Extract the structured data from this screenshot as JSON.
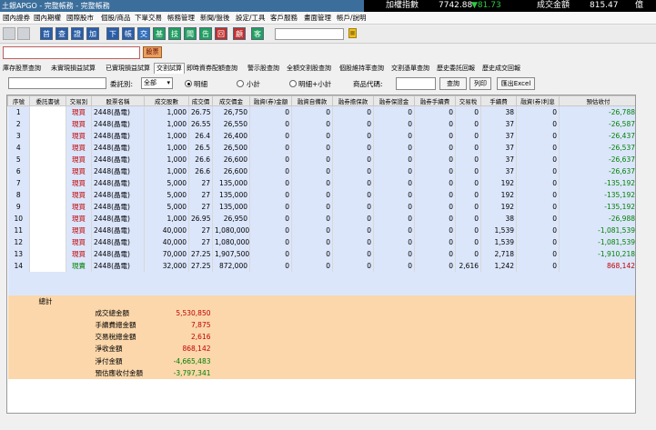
{
  "title": "土銀APGO - 完整帳務 - 完整帳務",
  "ticker": {
    "label": "加權指數",
    "value": "7742.88",
    "change": "▼81.73",
    "turnover_label": "成交金額",
    "turnover": "815.47",
    "unit": "億"
  },
  "menu": [
    "國內證券",
    "國內期權",
    "國際股市",
    "個股/商品",
    "下單交易",
    "帳務管理",
    "新聞/盤後",
    "設定/工具",
    "客戶服務",
    "畫面管理",
    "帳戶/說明"
  ],
  "toolbar": {
    "buttons": [
      "首",
      "查",
      "證",
      "加",
      "下",
      "帳",
      "交",
      "基",
      "技",
      "聞",
      "告",
      "回",
      "顧",
      "客"
    ],
    "combo_value": ""
  },
  "stock_button": "股票",
  "tabs": [
    "庫存股票查詢",
    "未實現損益試算",
    "已實現損益試算",
    "交割試算",
    "即時資券配額查詢",
    "警示股查詢",
    "全額交割股查詢",
    "個股維持率查詢",
    "交割憑單查詢",
    "歷史委託回報",
    "歷史成交回報"
  ],
  "filters": {
    "trade_label": "委託別:",
    "trade_value": "全部",
    "radio_detail": "明細",
    "radio_subtotal": "小計",
    "radio_both": "明細+小計",
    "product_label": "商品代碼:",
    "query": "查詢",
    "print": "列印",
    "export": "匯出Excel"
  },
  "columns": [
    "序號",
    "委託書號",
    "交易別",
    "股票名稱",
    "成交股數",
    "成交價",
    "成交價金",
    "融資(券)金額",
    "融資自備款",
    "融券擔保款",
    "融券保證金",
    "融券手續費",
    "交易稅",
    "手續費",
    "融資(券)利息",
    "預估收付"
  ],
  "rows": [
    {
      "no": "1",
      "side": "現買",
      "name": "2448(晶電)",
      "qty": "1,000",
      "price": "26.75",
      "amount": "26,750",
      "m1": "0",
      "m2": "0",
      "m3": "0",
      "m4": "0",
      "m5": "0",
      "tax": "0",
      "fee": "38",
      "int": "0",
      "net": "-26,788"
    },
    {
      "no": "2",
      "side": "現買",
      "name": "2448(晶電)",
      "qty": "1,000",
      "price": "26.55",
      "amount": "26,550",
      "m1": "0",
      "m2": "0",
      "m3": "0",
      "m4": "0",
      "m5": "0",
      "tax": "0",
      "fee": "37",
      "int": "0",
      "net": "-26,587"
    },
    {
      "no": "3",
      "side": "現買",
      "name": "2448(晶電)",
      "qty": "1,000",
      "price": "26.4",
      "amount": "26,400",
      "m1": "0",
      "m2": "0",
      "m3": "0",
      "m4": "0",
      "m5": "0",
      "tax": "0",
      "fee": "37",
      "int": "0",
      "net": "-26,437"
    },
    {
      "no": "4",
      "side": "現買",
      "name": "2448(晶電)",
      "qty": "1,000",
      "price": "26.5",
      "amount": "26,500",
      "m1": "0",
      "m2": "0",
      "m3": "0",
      "m4": "0",
      "m5": "0",
      "tax": "0",
      "fee": "37",
      "int": "0",
      "net": "-26,537"
    },
    {
      "no": "5",
      "side": "現買",
      "name": "2448(晶電)",
      "qty": "1,000",
      "price": "26.6",
      "amount": "26,600",
      "m1": "0",
      "m2": "0",
      "m3": "0",
      "m4": "0",
      "m5": "0",
      "tax": "0",
      "fee": "37",
      "int": "0",
      "net": "-26,637"
    },
    {
      "no": "6",
      "side": "現買",
      "name": "2448(晶電)",
      "qty": "1,000",
      "price": "26.6",
      "amount": "26,600",
      "m1": "0",
      "m2": "0",
      "m3": "0",
      "m4": "0",
      "m5": "0",
      "tax": "0",
      "fee": "37",
      "int": "0",
      "net": "-26,637"
    },
    {
      "no": "7",
      "side": "現買",
      "name": "2448(晶電)",
      "qty": "5,000",
      "price": "27",
      "amount": "135,000",
      "m1": "0",
      "m2": "0",
      "m3": "0",
      "m4": "0",
      "m5": "0",
      "tax": "0",
      "fee": "192",
      "int": "0",
      "net": "-135,192"
    },
    {
      "no": "8",
      "side": "現買",
      "name": "2448(晶電)",
      "qty": "5,000",
      "price": "27",
      "amount": "135,000",
      "m1": "0",
      "m2": "0",
      "m3": "0",
      "m4": "0",
      "m5": "0",
      "tax": "0",
      "fee": "192",
      "int": "0",
      "net": "-135,192"
    },
    {
      "no": "9",
      "side": "現買",
      "name": "2448(晶電)",
      "qty": "5,000",
      "price": "27",
      "amount": "135,000",
      "m1": "0",
      "m2": "0",
      "m3": "0",
      "m4": "0",
      "m5": "0",
      "tax": "0",
      "fee": "192",
      "int": "0",
      "net": "-135,192"
    },
    {
      "no": "10",
      "side": "現買",
      "name": "2448(晶電)",
      "qty": "1,000",
      "price": "26.95",
      "amount": "26,950",
      "m1": "0",
      "m2": "0",
      "m3": "0",
      "m4": "0",
      "m5": "0",
      "tax": "0",
      "fee": "38",
      "int": "0",
      "net": "-26,988"
    },
    {
      "no": "11",
      "side": "現買",
      "name": "2448(晶電)",
      "qty": "40,000",
      "price": "27",
      "amount": "1,080,000",
      "m1": "0",
      "m2": "0",
      "m3": "0",
      "m4": "0",
      "m5": "0",
      "tax": "0",
      "fee": "1,539",
      "int": "0",
      "net": "-1,081,539"
    },
    {
      "no": "12",
      "side": "現買",
      "name": "2448(晶電)",
      "qty": "40,000",
      "price": "27",
      "amount": "1,080,000",
      "m1": "0",
      "m2": "0",
      "m3": "0",
      "m4": "0",
      "m5": "0",
      "tax": "0",
      "fee": "1,539",
      "int": "0",
      "net": "-1,081,539"
    },
    {
      "no": "13",
      "side": "現買",
      "name": "2448(晶電)",
      "qty": "70,000",
      "price": "27.25",
      "amount": "1,907,500",
      "m1": "0",
      "m2": "0",
      "m3": "0",
      "m4": "0",
      "m5": "0",
      "tax": "0",
      "fee": "2,718",
      "int": "0",
      "net": "-1,910,218"
    },
    {
      "no": "14",
      "side": "現賣",
      "name": "2448(晶電)",
      "qty": "32,000",
      "price": "27.25",
      "amount": "872,000",
      "m1": "0",
      "m2": "0",
      "m3": "0",
      "m4": "0",
      "m5": "0",
      "tax": "2,616",
      "fee": "1,242",
      "int": "0",
      "net": "868,142"
    }
  ],
  "summary": {
    "title": "總計",
    "items": [
      {
        "label": "成交總金額",
        "value": "5,530,850",
        "color": "pos"
      },
      {
        "label": "手續費總金額",
        "value": "7,875",
        "color": "pos"
      },
      {
        "label": "交易稅總金額",
        "value": "2,616",
        "color": "pos"
      },
      {
        "label": "淨收金額",
        "value": "868,142",
        "color": "pos"
      },
      {
        "label": "淨付金額",
        "value": "-4,665,483",
        "color": "neg"
      },
      {
        "label": "預估應收付金額",
        "value": "-3,797,341",
        "color": "neg"
      }
    ]
  },
  "colors": {
    "buy": "#c00000",
    "sell": "#008000",
    "row_bg": "#dbe6fb",
    "summary_bg": "#fbd7ab"
  }
}
